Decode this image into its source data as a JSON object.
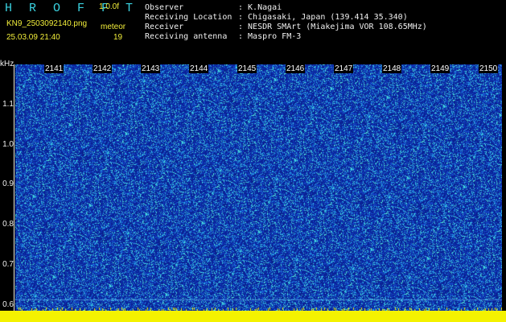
{
  "header": {
    "app_title": "H R O F F T",
    "version": "1.0.0f",
    "filename": "KN9_2503092140.png",
    "mode_label": "meteor",
    "timestamp": "25.03.09 21:40",
    "count": "19"
  },
  "info": {
    "labels": [
      "Observer",
      "Receiving Location",
      "Receiver",
      "Receiving antenna"
    ],
    "values": [
      ": K.Nagai",
      ": Chigasaki, Japan (139.414 35.340)",
      ": NESDR SMArt (Miakejima VOR 108.65MHz)",
      ": Maspro FM-3"
    ]
  },
  "axis": {
    "y_unit": "kHz",
    "y_ticks": [
      "1.1",
      "1.0",
      "0.9",
      "0.8",
      "0.7",
      "0.6"
    ],
    "x_ticks": [
      "2141",
      "2142",
      "2143",
      "2144",
      "2145",
      "2146",
      "2147",
      "2148",
      "2149",
      "2150"
    ]
  },
  "colors": {
    "background": "#000000",
    "spectrum_base": "#0a2290",
    "noise_cyan": "#2fd0ff",
    "bottom_band": "#f4f200",
    "header_cyan": "#3ad2e0",
    "header_yellow": "#f2ee3a"
  }
}
